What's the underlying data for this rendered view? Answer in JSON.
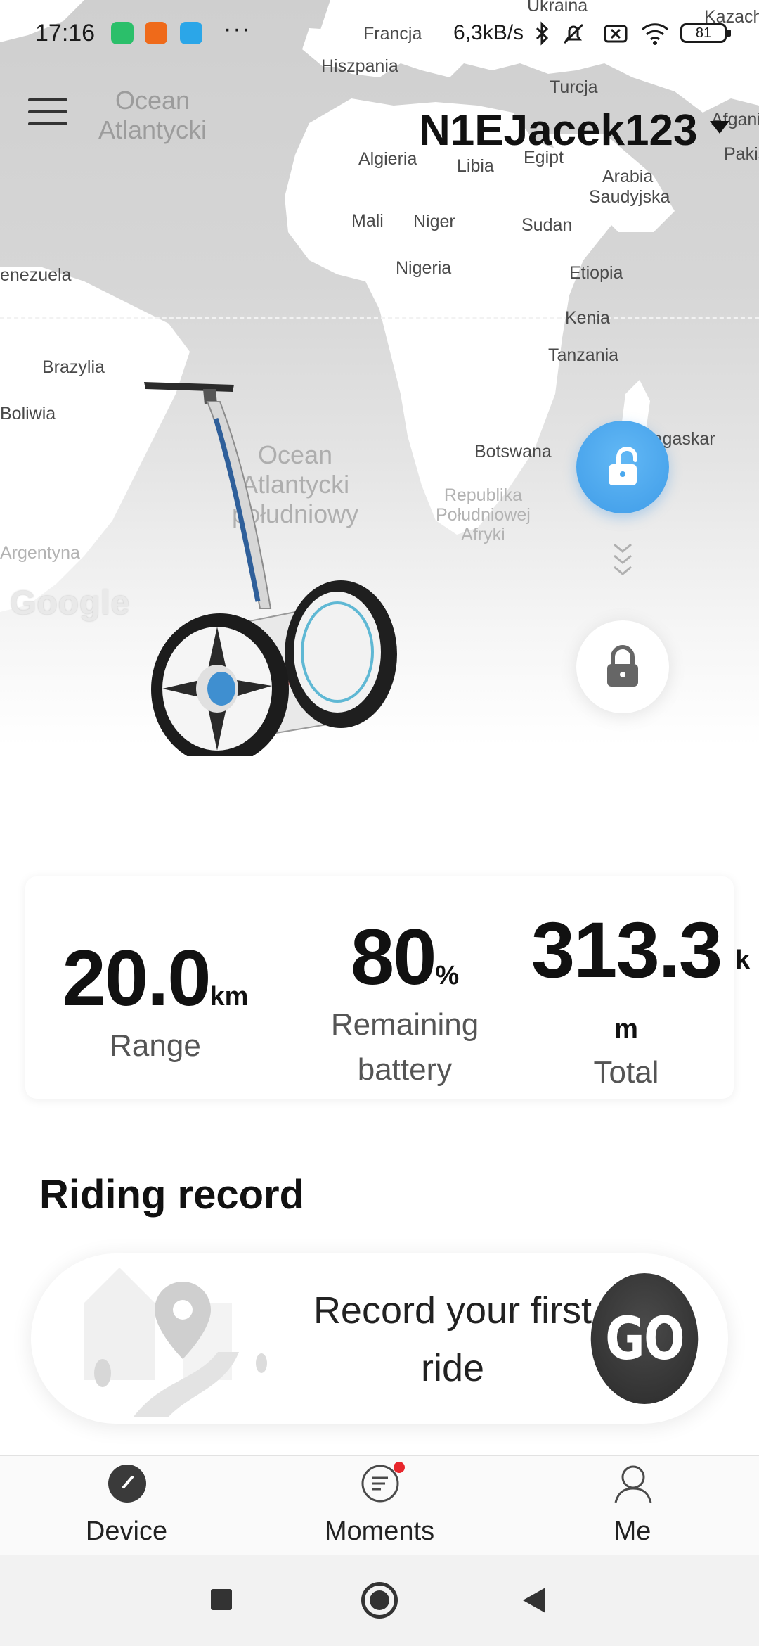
{
  "status_bar": {
    "time": "17:16",
    "more_indicator": "···",
    "net_speed": "6,3kB/s",
    "battery_level": "81"
  },
  "map": {
    "labels": {
      "ukraina": "Ukraina",
      "kazach": "Kazach",
      "francja": "Francja",
      "hiszpania": "Hiszpania",
      "turcja": "Turcja",
      "afgani": "Afgani",
      "pakis": "Pakis",
      "algieria": "Algieria",
      "libia": "Libia",
      "egipt": "Egipt",
      "arabia": "Arabia",
      "saudyjska": "Saudyjska",
      "mali": "Mali",
      "niger": "Niger",
      "sudan": "Sudan",
      "nigeria": "Nigeria",
      "etiopia": "Etiopia",
      "wenezuela": "enezuela",
      "kenia": "Kenia",
      "tanzania": "Tanzania",
      "brazylia": "Brazylia",
      "boliwia": "Boliwia",
      "botswana": "Botswana",
      "madagaskar": "Madagaskar",
      "rpa": "Republika\nPołudniowej\nAfryki",
      "argentyna": "Argentyna",
      "ocean_atl_n": "Ocean\nAtlantycki",
      "ocean_atl_s": "Ocean\nAtlantycki\npołudniowy"
    },
    "attribution": "Google"
  },
  "header": {
    "device_name": "N1EJacek123"
  },
  "stats": {
    "range": {
      "value": "20.0",
      "unit": "km",
      "label": "Range"
    },
    "battery": {
      "value": "80",
      "unit": "%",
      "label_line1": "Remaining",
      "label_line2": "battery"
    },
    "total": {
      "value": "313.3",
      "unit_k": "k",
      "unit_m": "m",
      "label": "Total"
    }
  },
  "riding_record": {
    "title": "Riding record",
    "prompt_line1": "Record your first",
    "prompt_line2": "ride",
    "go_label": "GO"
  },
  "tabs": [
    {
      "label": "Device"
    },
    {
      "label": "Moments"
    },
    {
      "label": "Me"
    }
  ],
  "colors": {
    "accent_blue": "#4aa8ee",
    "notification_red": "#e8262c",
    "go_button": "#333333"
  },
  "icons": {
    "menu": "menu-icon",
    "unlock": "unlock-icon",
    "lock": "lock-icon",
    "chevrons": "chevrons-down-icon",
    "device_tab": "speedometer-icon",
    "moments_tab": "chat-bubble-icon",
    "me_tab": "person-icon"
  }
}
